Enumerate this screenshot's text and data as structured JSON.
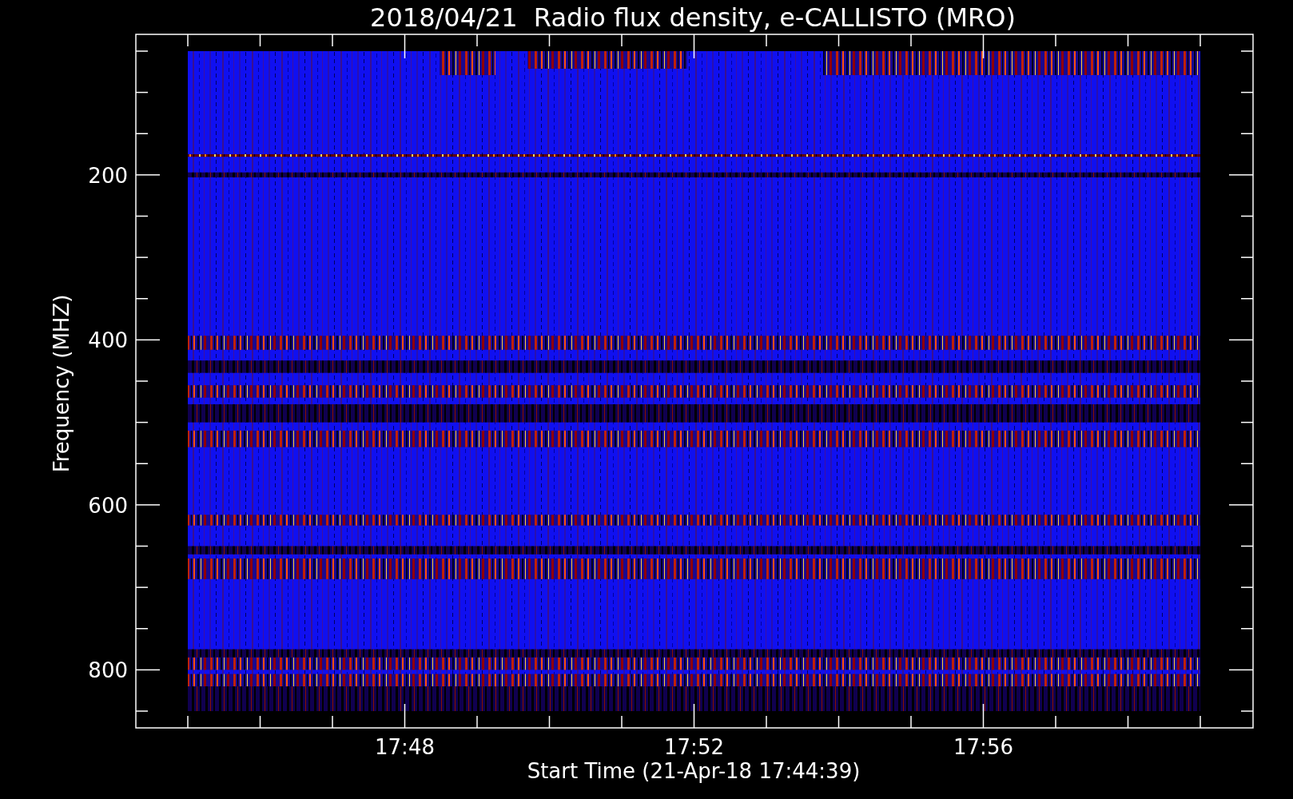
{
  "title": "2018/04/21  Radio flux density, e-CALLISTO (MRO)",
  "plot": {
    "ylabel": "Frequency (MHZ)",
    "xlabel": "Start Time (21-Apr-18 17:44:39)",
    "yticks": [
      "200",
      "400",
      "600",
      "800"
    ],
    "xticks": [
      "17:48",
      "17:52",
      "17:56"
    ]
  }
}
